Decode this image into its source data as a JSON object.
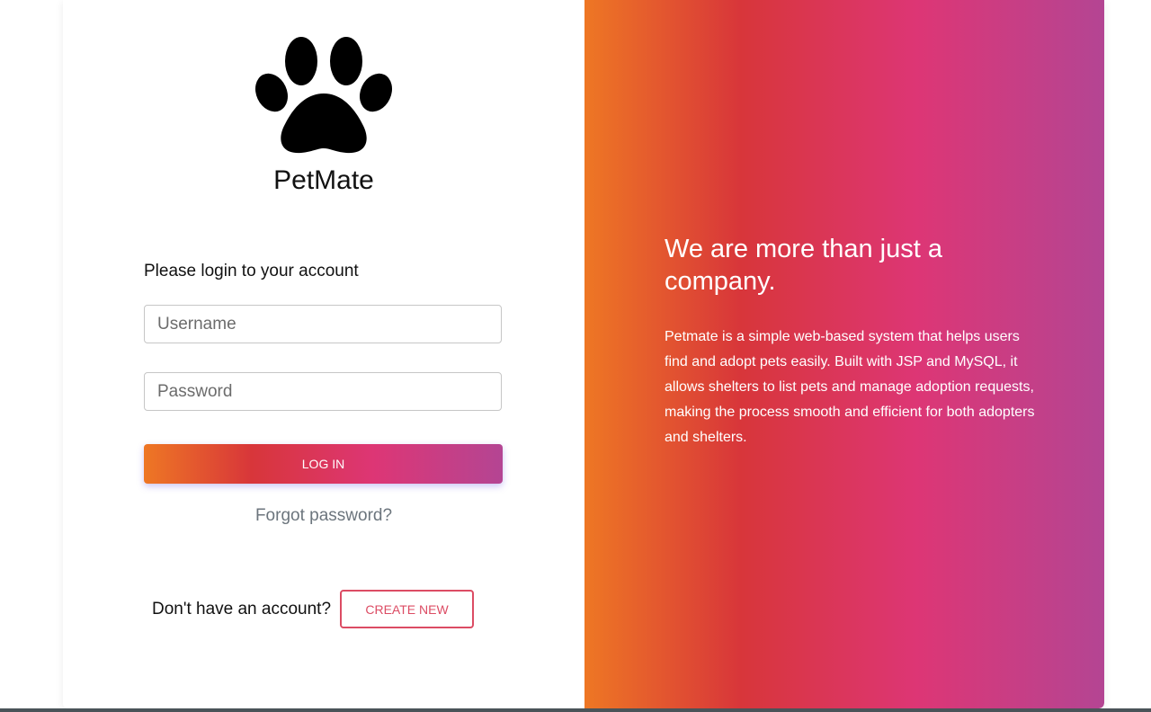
{
  "brand": {
    "name": "PetMate",
    "logo_icon": "paw-icon"
  },
  "login_form": {
    "subtitle": "Please login to your account",
    "username_placeholder": "Username",
    "password_placeholder": "Password",
    "login_label": "LOG IN",
    "forgot_label": "Forgot password?",
    "signup_prompt": "Don't have an account?",
    "create_label": "CREATE NEW"
  },
  "promo": {
    "headline": "We are more than just a company.",
    "description": "Petmate is a simple web-based system that helps users find and adopt pets easily. Built with JSP and MySQL, it allows shelters to list pets and manage adoption requests, making the process smooth and efficient for both adopters and shelters."
  },
  "colors": {
    "gradient": [
      "#ee7724",
      "#d8363a",
      "#dd3675",
      "#b44593"
    ],
    "create_button": "#dc4c64"
  }
}
